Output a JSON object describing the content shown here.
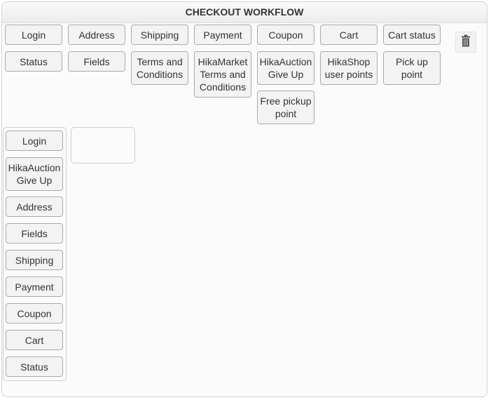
{
  "panel": {
    "title": "CHECKOUT WORKFLOW"
  },
  "available_steps": [
    {
      "label": "Login"
    },
    {
      "label": "Address"
    },
    {
      "label": "Shipping"
    },
    {
      "label": "Payment"
    },
    {
      "label": "Coupon"
    },
    {
      "label": "Cart"
    },
    {
      "label": "Cart status"
    },
    {
      "label": "Status"
    },
    {
      "label": "Fields"
    },
    {
      "label": "Terms and Conditions"
    },
    {
      "label": "HikaMarket Terms and Conditions"
    },
    {
      "label": "HikaAuction Give Up"
    },
    {
      "label": "HikaShop user points"
    },
    {
      "label": "Pick up point"
    },
    {
      "label": "Free pickup point"
    }
  ],
  "trash": {
    "icon": "trash-icon"
  },
  "workflow_columns": [
    {
      "steps": [
        {
          "label": "Login"
        },
        {
          "label": "HikaAuction Give Up"
        },
        {
          "label": "Address"
        },
        {
          "label": "Fields"
        },
        {
          "label": "Shipping"
        },
        {
          "label": "Payment"
        },
        {
          "label": "Coupon"
        },
        {
          "label": "Cart"
        },
        {
          "label": "Status"
        }
      ]
    },
    {
      "steps": []
    }
  ]
}
